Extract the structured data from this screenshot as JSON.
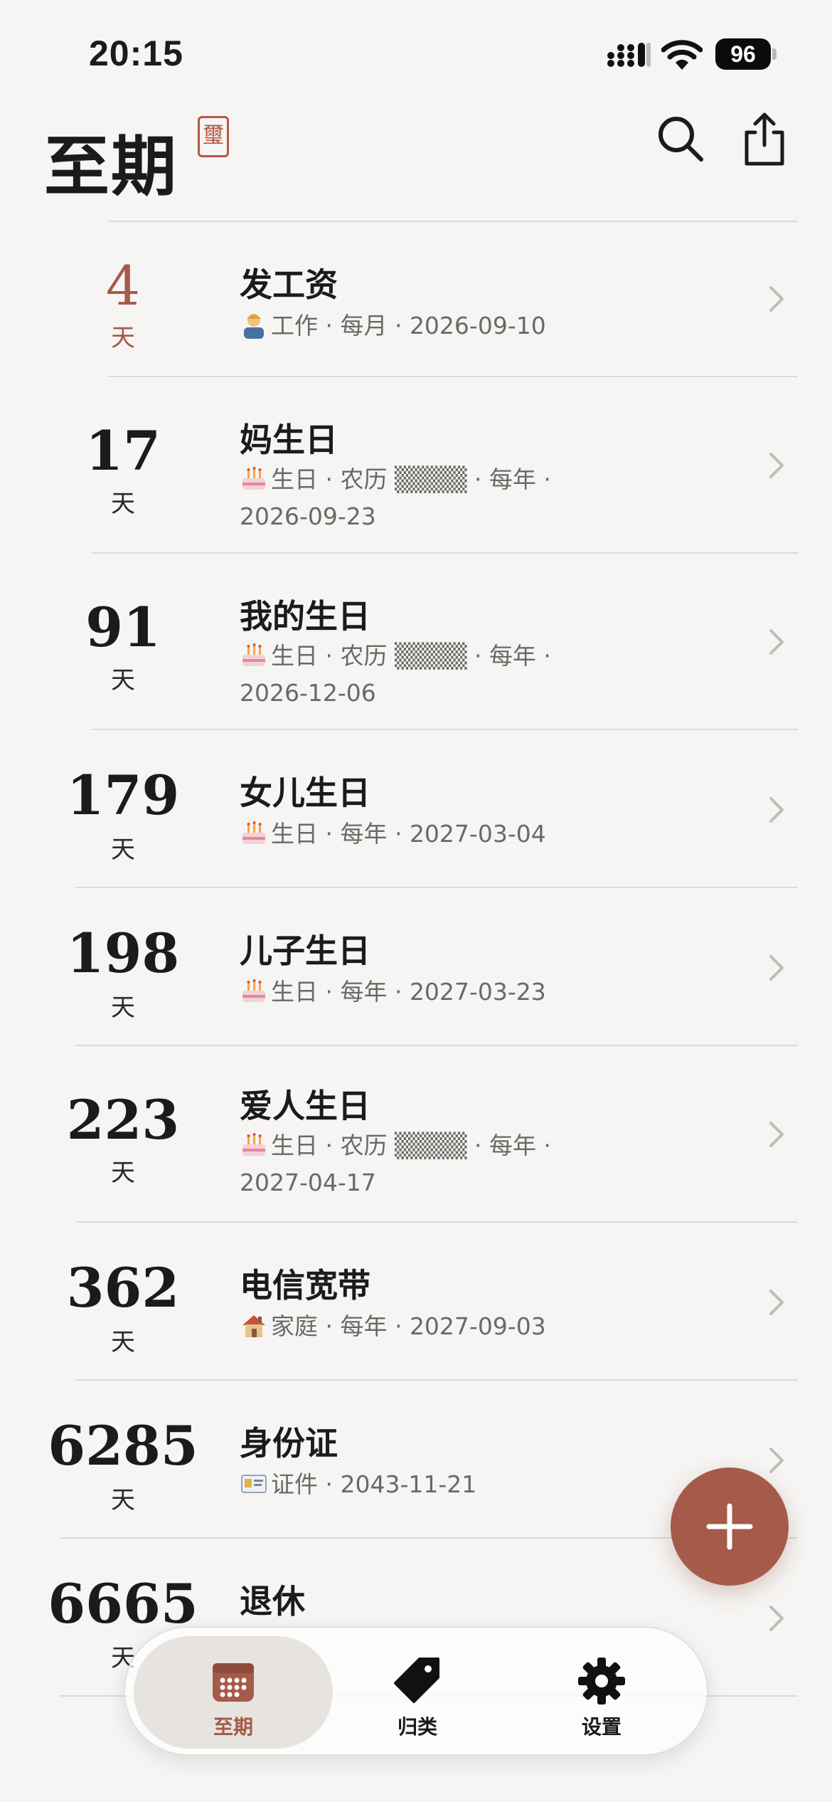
{
  "status_bar": {
    "time": "20:15",
    "battery": "96"
  },
  "header": {
    "title": "至期",
    "seal": "璽"
  },
  "colors": {
    "accent": "#a65a49",
    "background": "#f6f5f3",
    "text": "#1c1b1a",
    "muted": "#6b6966"
  },
  "items": [
    {
      "days": "4",
      "unit": "天",
      "title": "发工资",
      "icon": "worker-emoji-icon",
      "meta_line1": "工作 · 每月 · 2026-09-10",
      "meta_line2": "",
      "accent": true
    },
    {
      "days": "17",
      "unit": "天",
      "title": "妈生日",
      "icon": "birthday-cake-icon",
      "meta_line1": "生日 · 农历 ▒▒▒▒ · 每年 ·",
      "meta_line2": "2026-09-23"
    },
    {
      "days": "91",
      "unit": "天",
      "title": "我的生日",
      "icon": "birthday-cake-icon",
      "meta_line1": "生日 · 农历 ▒▒▒▒ · 每年 ·",
      "meta_line2": "2026-12-06"
    },
    {
      "days": "179",
      "unit": "天",
      "title": "女儿生日",
      "icon": "birthday-cake-icon",
      "meta_line1": "生日 · 每年 · 2027-03-04",
      "meta_line2": ""
    },
    {
      "days": "198",
      "unit": "天",
      "title": "儿子生日",
      "icon": "birthday-cake-icon",
      "meta_line1": "生日 · 每年 · 2027-03-23",
      "meta_line2": ""
    },
    {
      "days": "223",
      "unit": "天",
      "title": "爱人生日",
      "icon": "birthday-cake-icon",
      "meta_line1": "生日 · 农历 ▒▒▒▒ · 每年 ·",
      "meta_line2": "2027-04-17"
    },
    {
      "days": "362",
      "unit": "天",
      "title": "电信宽带",
      "icon": "house-icon",
      "meta_line1": "家庭 · 每年 · 2027-09-03",
      "meta_line2": ""
    },
    {
      "days": "6285",
      "unit": "天",
      "title": "身份证",
      "icon": "id-card-icon",
      "meta_line1": "证件 · 2043-11-21",
      "meta_line2": ""
    },
    {
      "days": "6665",
      "unit": "天",
      "title": "退休",
      "icon": "",
      "meta_line1": "",
      "meta_line2": ""
    }
  ],
  "tabs": [
    {
      "label": "至期",
      "icon": "calendar-icon",
      "active": true
    },
    {
      "label": "归类",
      "icon": "tag-icon",
      "active": false
    },
    {
      "label": "设置",
      "icon": "gear-icon",
      "active": false
    }
  ]
}
